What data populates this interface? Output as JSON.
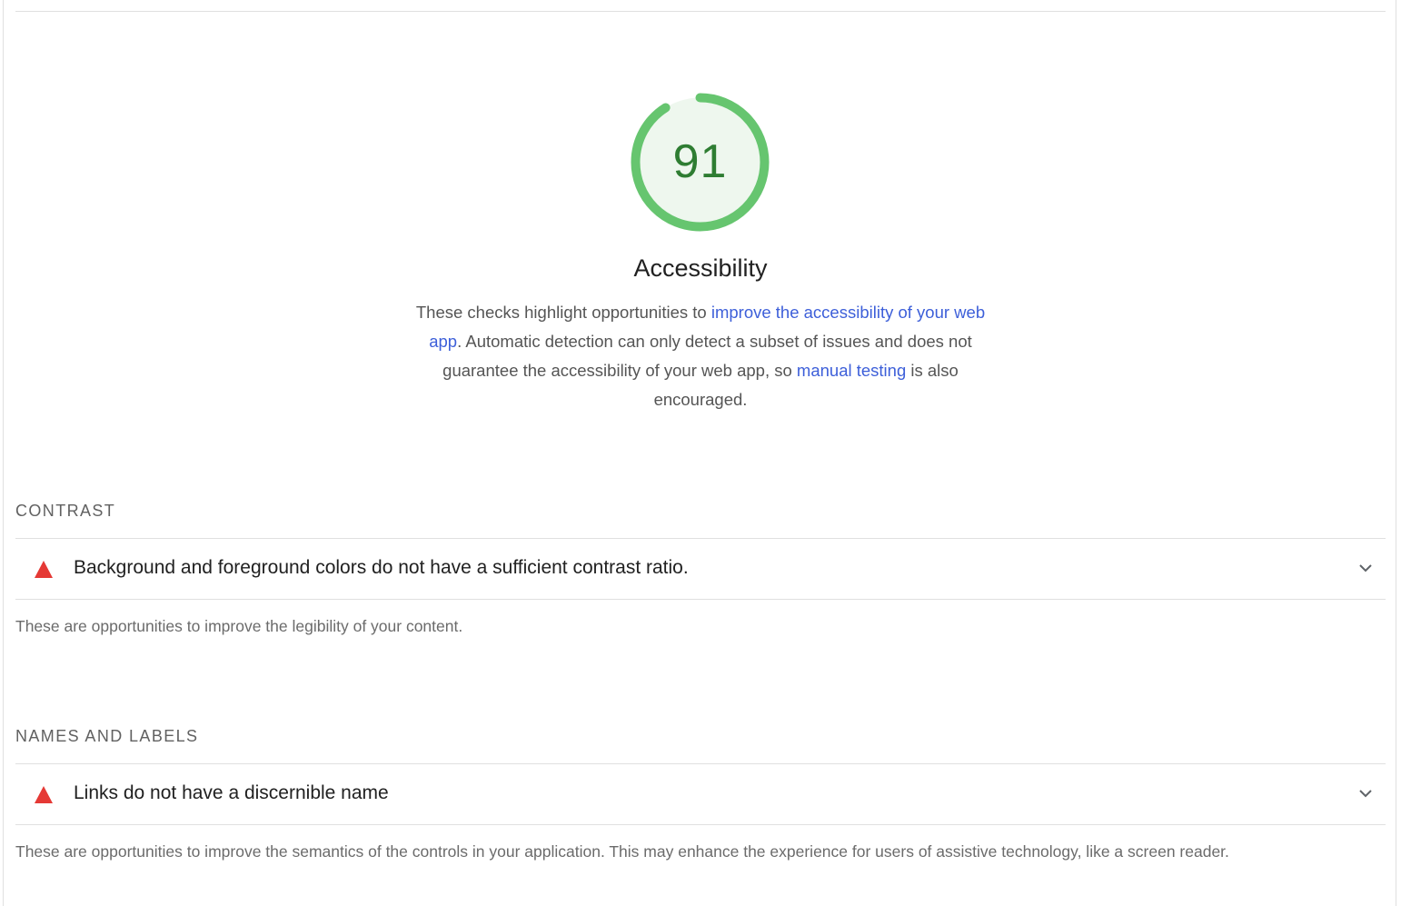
{
  "category": {
    "score": "91",
    "score_fraction": 0.91,
    "title": "Accessibility",
    "description_parts": {
      "p1": "These checks highlight opportunities to ",
      "link1": "improve the accessibility of your web app",
      "p2": ". Automatic detection can only detect a subset of issues and does not guarantee the accessibility of your web app, so ",
      "link2": "manual testing",
      "p3": " is also encouraged."
    },
    "colors": {
      "pass_stroke": "#66c56f",
      "pass_fill": "#eef7ee",
      "score_text": "#2e7d32",
      "fail_icon": "#e53935",
      "link": "#3d5fd9"
    }
  },
  "groups": [
    {
      "title": "CONTRAST",
      "audit": {
        "label": "Background and foreground colors do not have a sufficient contrast ratio.",
        "status_icon": "fail-triangle-icon"
      },
      "description": "These are opportunities to improve the legibility of your content."
    },
    {
      "title": "NAMES AND LABELS",
      "audit": {
        "label": "Links do not have a discernible name",
        "status_icon": "fail-triangle-icon"
      },
      "description": "These are opportunities to improve the semantics of the controls in your application. This may enhance the experience for users of assistive technology, like a screen reader."
    }
  ]
}
